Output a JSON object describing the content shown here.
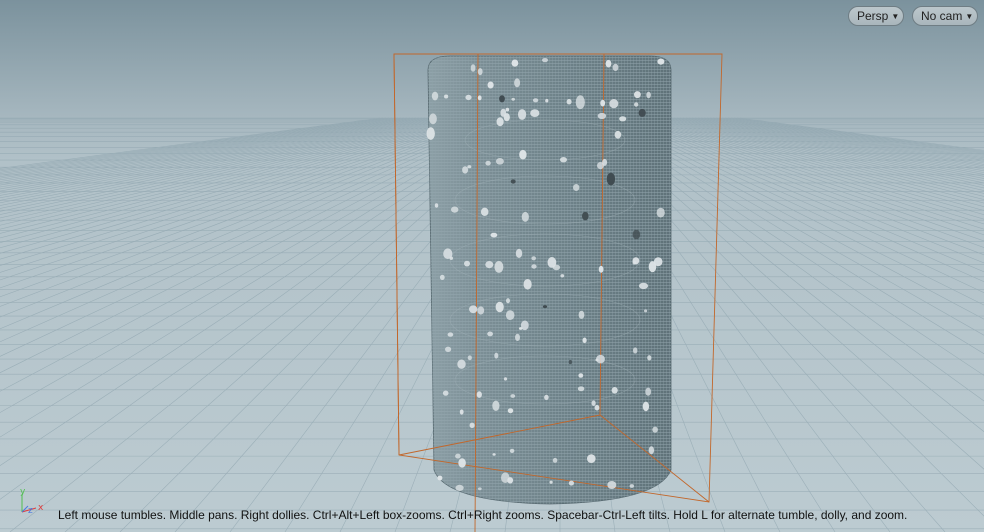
{
  "viewport": {
    "view_menu": {
      "label": "Persp",
      "icon": "caret-down-icon"
    },
    "camera_menu": {
      "label": "No cam",
      "icon": "caret-down-icon"
    },
    "status_hint": "Left mouse tumbles. Middle pans. Right dollies. Ctrl+Alt+Left box-zooms. Ctrl+Right zooms. Spacebar-Ctrl-Left tilts. Hold L for alternate tumble, dolly, and zoom.",
    "axes": {
      "y": "y",
      "x": "x",
      "z": "z"
    },
    "colors": {
      "sky_top": "#7b929d",
      "horizon": "#b1c1c8",
      "grid_line": "#8ea4ae",
      "cylinder": "#73878e",
      "bounding_box": "#c2672b",
      "particles": "#dde3e6",
      "axis_x": "#e03c3c",
      "axis_y": "#4fbf4f",
      "axis_z": "#4a78e0"
    }
  }
}
